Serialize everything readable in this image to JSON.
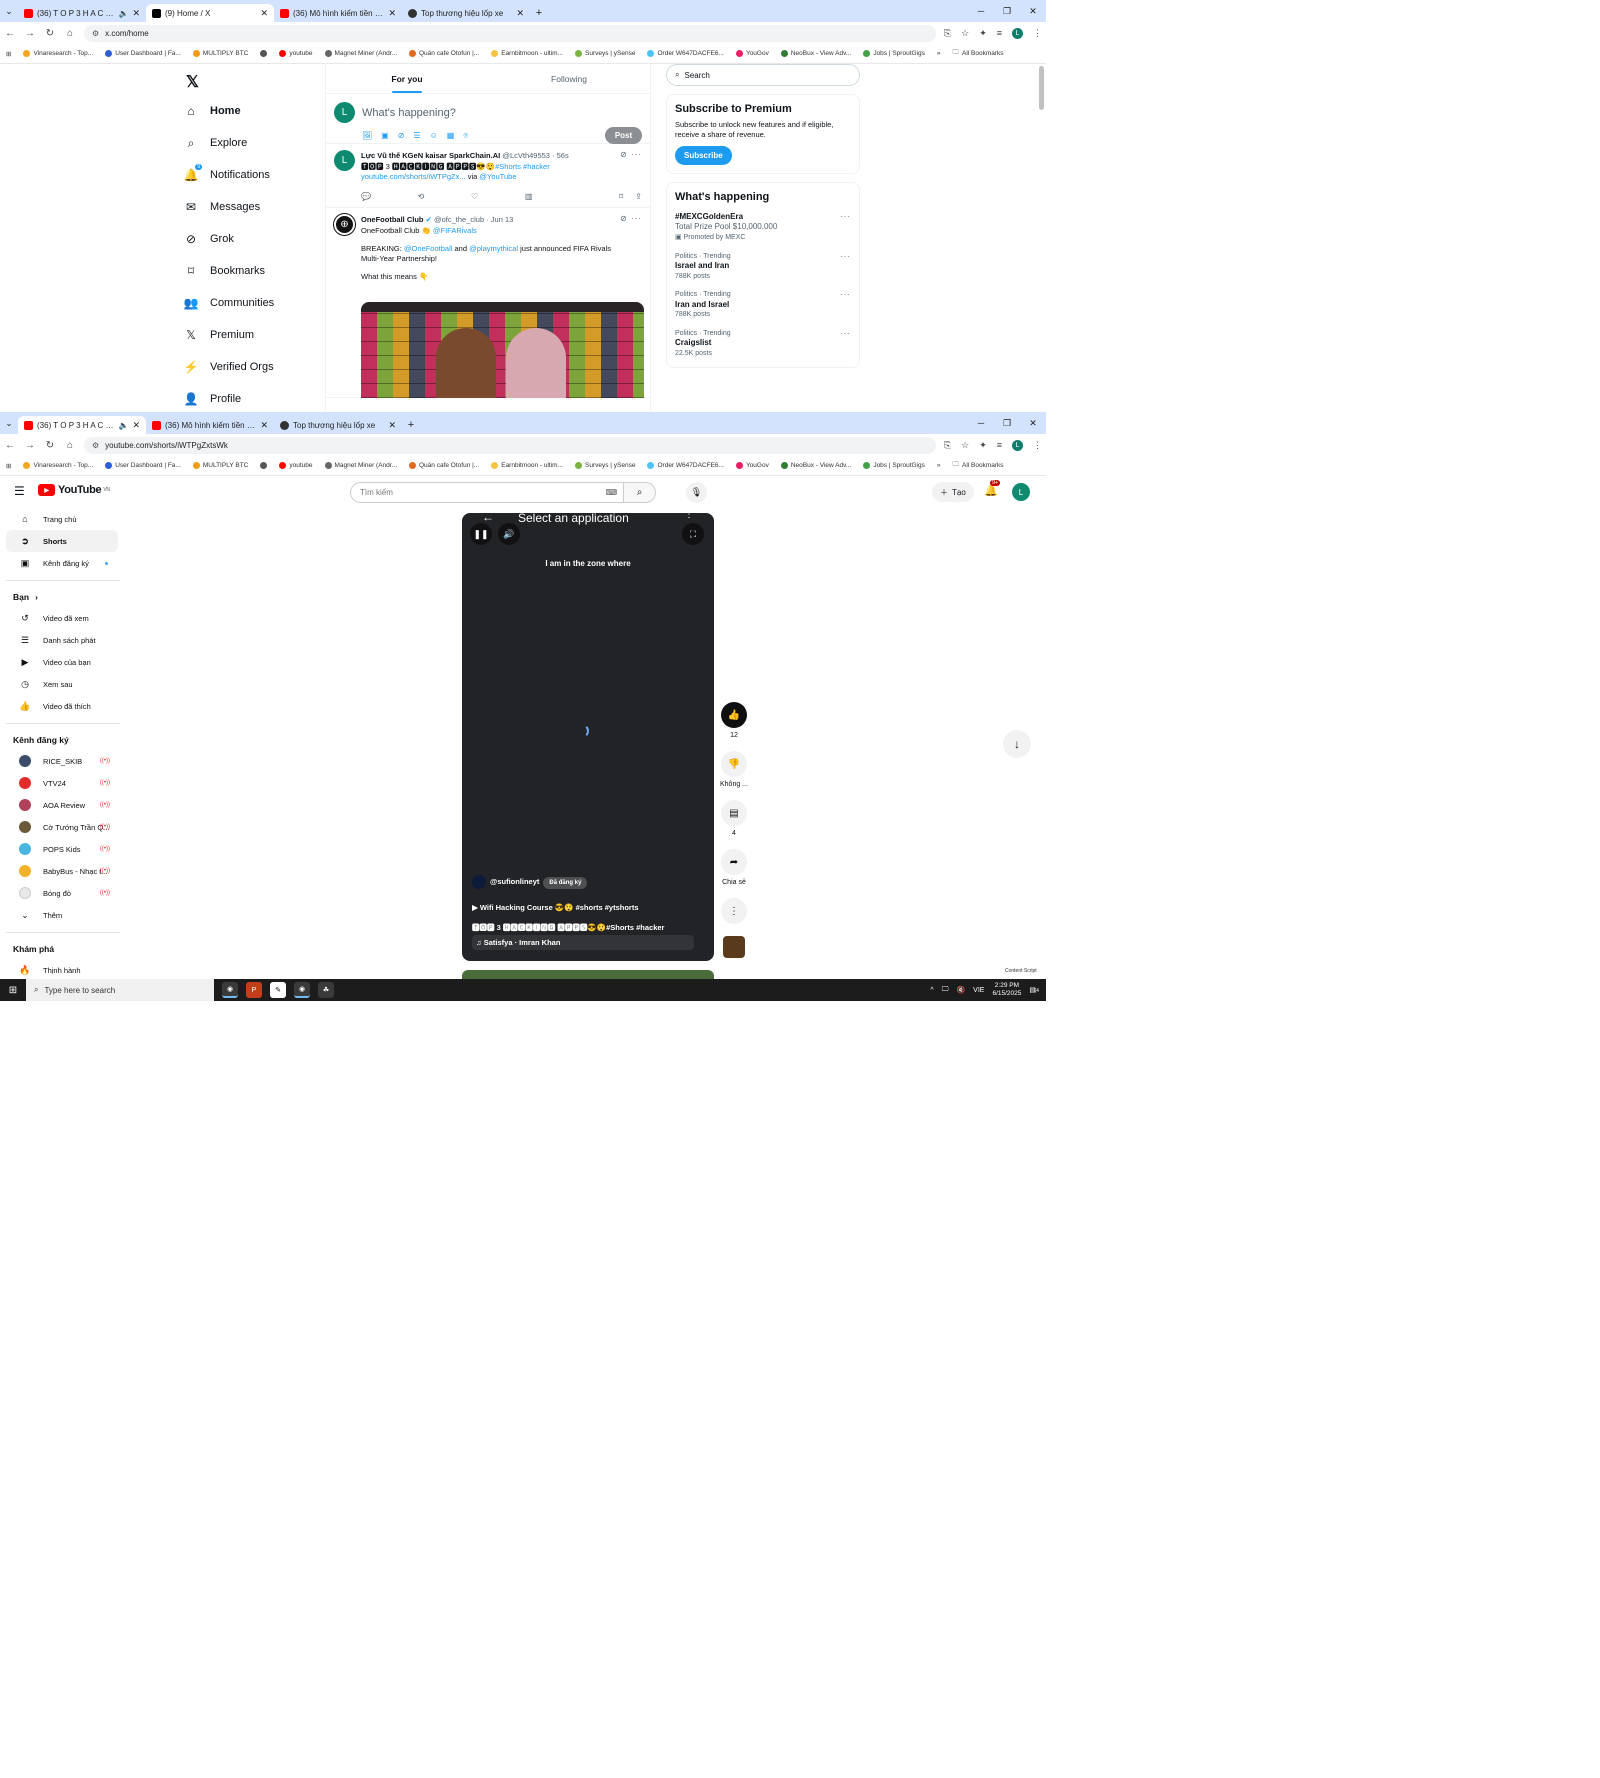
{
  "window1": {
    "tabs": [
      {
        "title": "(36) T O P 3 H A C K I N",
        "active": false,
        "favicon": "youtube-icon"
      },
      {
        "title": "(9) Home / X",
        "active": true,
        "favicon": "x-icon"
      },
      {
        "title": "(36) Mô hình kiếm tiền online",
        "active": false,
        "favicon": "youtube-icon"
      },
      {
        "title": "Top thương hiệu lốp xe",
        "active": false,
        "favicon": "globe-icon"
      }
    ],
    "url": "x.com/home"
  },
  "window2": {
    "tabs": [
      {
        "title": "(36) T O P 3 H A C K I N",
        "active": true,
        "favicon": "youtube-icon"
      },
      {
        "title": "(36) Mô hình kiếm tiền online",
        "active": false,
        "favicon": "youtube-icon"
      },
      {
        "title": "Top thương hiệu lốp xe",
        "active": false,
        "favicon": "globe-icon"
      }
    ],
    "url": "youtube.com/shorts/iWTPgZxtsWk"
  },
  "bookmarks": [
    "Vinaresearch - Top...",
    "User Dashboard | Fa...",
    "MULTIPLY BTC",
    "",
    "youtube",
    "Magnet Miner (Andr...",
    "Quán cafe Otofun |...",
    "Earnbitmoon - ultim...",
    "Surveys | ySense",
    "Order W647DACFE6...",
    "YouGov",
    "NeoBux - View Adv...",
    "Jobs | SproutGigs"
  ],
  "bookmarks_more": "»",
  "all_bookmarks": "All Bookmarks",
  "x": {
    "nav": [
      {
        "label": "Home",
        "icon": "home-icon"
      },
      {
        "label": "Explore",
        "icon": "search-icon"
      },
      {
        "label": "Notifications",
        "icon": "bell-icon"
      },
      {
        "label": "Messages",
        "icon": "mail-icon"
      },
      {
        "label": "Grok",
        "icon": "grok-icon"
      },
      {
        "label": "Bookmarks",
        "icon": "bookmark-icon"
      },
      {
        "label": "Communities",
        "icon": "people-icon"
      },
      {
        "label": "Premium",
        "icon": "x-icon"
      },
      {
        "label": "Verified Orgs",
        "icon": "lightning-icon"
      },
      {
        "label": "Profile",
        "icon": "person-icon"
      }
    ],
    "notif_count": "9",
    "tabs": [
      "For you",
      "Following"
    ],
    "compose_avatar": "L",
    "compose_placeholder": "What's happening?",
    "post_label": "Post",
    "tweet1": {
      "avatar": "L",
      "name": "Lực Vũ thế KGeN kaisar SparkChain.AI",
      "handle": "@LcVth49553 · 56s",
      "line1": "🆃🅾🅿 3 🅷🅰🅲🅺🅸🅽🅶 🅰🅿🅿🆂😎😲",
      "tags": "#Shorts #hacker",
      "link": "youtube.com/shorts/iWTPgZx...",
      "via": "via",
      "via_handle": "@YouTube"
    },
    "tweet2": {
      "name": "OneFootball Club",
      "handle": "@ofc_the_club · Jun 13",
      "line1": "OneFootball Club 👏",
      "mention1": "@FIFARivals",
      "breaking": "BREAKING:",
      "mention2": "@OneFootball",
      "and": "and",
      "mention3": "@playmythical",
      "rest": "just announced FIFA Rivals",
      "line3": "Multi-Year Partnership!",
      "line4": "What this means 👇"
    },
    "search_placeholder": "Search",
    "premium": {
      "title": "Subscribe to Premium",
      "body": "Subscribe to unlock new features and if eligible, receive a share of revenue.",
      "button": "Subscribe"
    },
    "happening_title": "What's happening",
    "trends": [
      {
        "name": "#MEXCGoldenEra",
        "meta": "Total Prize Pool $10,000,000",
        "sub": "Promoted by MEXC"
      },
      {
        "cat": "Politics · Trending",
        "name": "Israel and Iran",
        "sub": "788K posts"
      },
      {
        "cat": "Politics · Trending",
        "name": "Iran and Israel",
        "sub": "788K posts"
      },
      {
        "cat": "Politics · Trending",
        "name": "Craigslist",
        "sub": "22.5K posts"
      }
    ]
  },
  "yt": {
    "logo": "YouTube",
    "region": "VN",
    "search_placeholder": "Tìm kiếm",
    "create_label": "Tạo",
    "notif_count": "9+",
    "avatar": "L",
    "nav_main": [
      {
        "label": "Trang chủ",
        "icon": "home-icon"
      },
      {
        "label": "Shorts",
        "icon": "shorts-icon"
      },
      {
        "label": "Kênh đăng ký",
        "icon": "subscriptions-icon"
      }
    ],
    "you_header": "Bạn",
    "nav_you": [
      {
        "label": "Video đã xem",
        "icon": "history-icon"
      },
      {
        "label": "Danh sách phát",
        "icon": "playlist-icon"
      },
      {
        "label": "Video của bạn",
        "icon": "video-icon"
      },
      {
        "label": "Xem sau",
        "icon": "clock-icon"
      },
      {
        "label": "Video đã thích",
        "icon": "like-icon"
      }
    ],
    "subs_header": "Kênh đăng ký",
    "subs": [
      {
        "label": "RICE_SKIB",
        "color": "#3b4c6b"
      },
      {
        "label": "VTV24",
        "color": "#e32b2b"
      },
      {
        "label": "AOA Review",
        "color": "#b0415a"
      },
      {
        "label": "Cờ Tướng Trần Q...",
        "color": "#6b5a3a"
      },
      {
        "label": "POPS Kids",
        "color": "#49b6e0"
      },
      {
        "label": "BabyBus - Nhạc t...",
        "color": "#f3b22b"
      },
      {
        "label": "Bóng đỏ",
        "color": "#e9e9e9"
      }
    ],
    "more_label": "Thêm",
    "explore_header": "Khám phá",
    "explore_item": "Thịnh hành",
    "player": {
      "overlay": "Select an application",
      "caption": "I am in the zone where",
      "channel": "@sufionlineyt",
      "subscribed": "Đã đăng ký",
      "playlist": "Wifi Hacking Course 😎😲 #shorts #ytshorts",
      "title": "🆃🅾🅿 3 🅷🅰🅲🅺🅸🅽🅶 🅰🅿🅿🆂😎😲#Shorts #hacker",
      "music": "Satisfya · Imran Khan"
    },
    "actions": {
      "likes": "12",
      "dislike": "Không ...",
      "comments": "4",
      "share": "Chia sẻ"
    },
    "content_script": "Content Script"
  },
  "taskbar": {
    "search": "Type here to search",
    "lang": "VIE",
    "time": "2:29 PM",
    "date": "6/15/2025",
    "notif": "14"
  }
}
